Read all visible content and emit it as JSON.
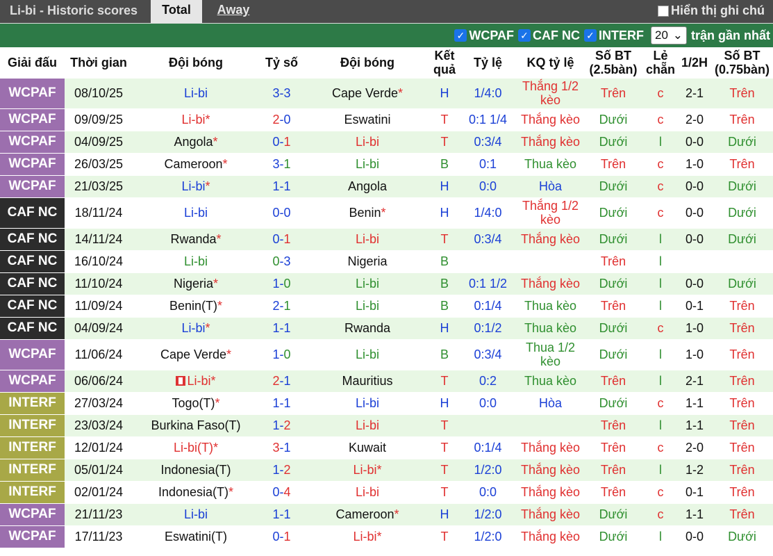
{
  "header": {
    "title": "Li-bi - Historic scores",
    "tabs": [
      "Total",
      "Away"
    ],
    "home_toggle_label": "Hiển thị ghi chú"
  },
  "filters": {
    "items": [
      "WCPAF",
      "CAF NC",
      "INTERF"
    ],
    "count_value": "20",
    "recent_label": "trận gần nhất"
  },
  "columns": [
    "Giải đấu",
    "Thời gian",
    "Đội bóng",
    "Tỷ số",
    "Đội bóng",
    "Kết quả",
    "Tỷ lệ",
    "KQ tỷ lệ",
    "Số BT (2.5bàn)",
    "Lẻ chẵn",
    "1/2H",
    "Số BT (0.75bàn)"
  ],
  "colors": {
    "WCPAF": "#9c6fae",
    "CAF NC": "#2c2c2c",
    "INTERF": "#a8a847",
    "win_text": "#e03030",
    "draw_text": "#1a3fd6",
    "loss_text": "#2f8f2f"
  },
  "rows": [
    {
      "league": "WCPAF",
      "date": "08/10/25",
      "home": "Li-bi",
      "home_star": false,
      "score_h": "3",
      "score_a": "3",
      "away": "Cape Verde",
      "away_star": true,
      "result": "H",
      "odds": "1/4:0",
      "odds_result": "Thắng 1/2 kèo",
      "ou": "Trên",
      "oe": "c",
      "half": "2-1",
      "ou2": "Trên"
    },
    {
      "league": "WCPAF",
      "date": "09/09/25",
      "home": "Li-bi",
      "home_star": true,
      "score_h": "2",
      "score_a": "0",
      "away": "Eswatini",
      "away_star": false,
      "result": "T",
      "odds": "0:1 1/4",
      "odds_result": "Thắng kèo",
      "ou": "Dưới",
      "oe": "c",
      "half": "2-0",
      "ou2": "Trên"
    },
    {
      "league": "WCPAF",
      "date": "04/09/25",
      "home": "Angola",
      "home_star": true,
      "score_h": "0",
      "score_a": "1",
      "away": "Li-bi",
      "away_star": false,
      "result": "T",
      "odds": "0:3/4",
      "odds_result": "Thắng kèo",
      "ou": "Dưới",
      "oe": "l",
      "half": "0-0",
      "ou2": "Dưới"
    },
    {
      "league": "WCPAF",
      "date": "26/03/25",
      "home": "Cameroon",
      "home_star": true,
      "score_h": "3",
      "score_a": "1",
      "away": "Li-bi",
      "away_star": false,
      "result": "B",
      "odds": "0:1",
      "odds_result": "Thua kèo",
      "ou": "Trên",
      "oe": "c",
      "half": "1-0",
      "ou2": "Trên"
    },
    {
      "league": "WCPAF",
      "date": "21/03/25",
      "home": "Li-bi",
      "home_star": true,
      "score_h": "1",
      "score_a": "1",
      "away": "Angola",
      "away_star": false,
      "result": "H",
      "odds": "0:0",
      "odds_result": "Hòa",
      "ou": "Dưới",
      "oe": "c",
      "half": "0-0",
      "ou2": "Dưới"
    },
    {
      "league": "CAF NC",
      "date": "18/11/24",
      "home": "Li-bi",
      "home_star": false,
      "score_h": "0",
      "score_a": "0",
      "away": "Benin",
      "away_star": true,
      "result": "H",
      "odds": "1/4:0",
      "odds_result": "Thắng 1/2 kèo",
      "ou": "Dưới",
      "oe": "c",
      "half": "0-0",
      "ou2": "Dưới"
    },
    {
      "league": "CAF NC",
      "date": "14/11/24",
      "home": "Rwanda",
      "home_star": true,
      "score_h": "0",
      "score_a": "1",
      "away": "Li-bi",
      "away_star": false,
      "result": "T",
      "odds": "0:3/4",
      "odds_result": "Thắng kèo",
      "ou": "Dưới",
      "oe": "l",
      "half": "0-0",
      "ou2": "Dưới"
    },
    {
      "league": "CAF NC",
      "date": "16/10/24",
      "home": "Li-bi",
      "home_star": false,
      "score_h": "0",
      "score_a": "3",
      "away": "Nigeria",
      "away_star": false,
      "result": "B",
      "odds": "",
      "odds_result": "",
      "ou": "Trên",
      "oe": "l",
      "half": "",
      "ou2": ""
    },
    {
      "league": "CAF NC",
      "date": "11/10/24",
      "home": "Nigeria",
      "home_star": true,
      "score_h": "1",
      "score_a": "0",
      "away": "Li-bi",
      "away_star": false,
      "result": "B",
      "odds": "0:1 1/2",
      "odds_result": "Thắng kèo",
      "ou": "Dưới",
      "oe": "l",
      "half": "0-0",
      "ou2": "Dưới"
    },
    {
      "league": "CAF NC",
      "date": "11/09/24",
      "home": "Benin(T)",
      "home_star": true,
      "score_h": "2",
      "score_a": "1",
      "away": "Li-bi",
      "away_star": false,
      "result": "B",
      "odds": "0:1/4",
      "odds_result": "Thua kèo",
      "ou": "Trên",
      "oe": "l",
      "half": "0-1",
      "ou2": "Trên"
    },
    {
      "league": "CAF NC",
      "date": "04/09/24",
      "home": "Li-bi",
      "home_star": true,
      "score_h": "1",
      "score_a": "1",
      "away": "Rwanda",
      "away_star": false,
      "result": "H",
      "odds": "0:1/2",
      "odds_result": "Thua kèo",
      "ou": "Dưới",
      "oe": "c",
      "half": "1-0",
      "ou2": "Trên"
    },
    {
      "league": "WCPAF",
      "date": "11/06/24",
      "home": "Cape Verde",
      "home_star": true,
      "score_h": "1",
      "score_a": "0",
      "away": "Li-bi",
      "away_star": false,
      "result": "B",
      "odds": "0:3/4",
      "odds_result": "Thua 1/2 kèo",
      "ou": "Dưới",
      "oe": "l",
      "half": "1-0",
      "ou2": "Trên"
    },
    {
      "league": "WCPAF",
      "date": "06/06/24",
      "home": "Li-bi",
      "home_star": true,
      "home_flag": true,
      "score_h": "2",
      "score_a": "1",
      "away": "Mauritius",
      "away_star": false,
      "result": "T",
      "odds": "0:2",
      "odds_result": "Thua kèo",
      "ou": "Trên",
      "oe": "l",
      "half": "2-1",
      "ou2": "Trên"
    },
    {
      "league": "INTERF",
      "date": "27/03/24",
      "home": "Togo(T)",
      "home_star": true,
      "score_h": "1",
      "score_a": "1",
      "away": "Li-bi",
      "away_star": false,
      "result": "H",
      "odds": "0:0",
      "odds_result": "Hòa",
      "ou": "Dưới",
      "oe": "c",
      "half": "1-1",
      "ou2": "Trên"
    },
    {
      "league": "INTERF",
      "date": "23/03/24",
      "home": "Burkina Faso(T)",
      "home_star": false,
      "score_h": "1",
      "score_a": "2",
      "away": "Li-bi",
      "away_star": false,
      "result": "T",
      "odds": "",
      "odds_result": "",
      "ou": "Trên",
      "oe": "l",
      "half": "1-1",
      "ou2": "Trên"
    },
    {
      "league": "INTERF",
      "date": "12/01/24",
      "home": "Li-bi(T)",
      "home_star": true,
      "score_h": "3",
      "score_a": "1",
      "away": "Kuwait",
      "away_star": false,
      "result": "T",
      "odds": "0:1/4",
      "odds_result": "Thắng kèo",
      "ou": "Trên",
      "oe": "c",
      "half": "2-0",
      "ou2": "Trên"
    },
    {
      "league": "INTERF",
      "date": "05/01/24",
      "home": "Indonesia(T)",
      "home_star": false,
      "score_h": "1",
      "score_a": "2",
      "away": "Li-bi",
      "away_star": true,
      "result": "T",
      "odds": "1/2:0",
      "odds_result": "Thắng kèo",
      "ou": "Trên",
      "oe": "l",
      "half": "1-2",
      "ou2": "Trên"
    },
    {
      "league": "INTERF",
      "date": "02/01/24",
      "home": "Indonesia(T)",
      "home_star": true,
      "score_h": "0",
      "score_a": "4",
      "away": "Li-bi",
      "away_star": false,
      "result": "T",
      "odds": "0:0",
      "odds_result": "Thắng kèo",
      "ou": "Trên",
      "oe": "c",
      "half": "0-1",
      "ou2": "Trên"
    },
    {
      "league": "WCPAF",
      "date": "21/11/23",
      "home": "Li-bi",
      "home_star": false,
      "score_h": "1",
      "score_a": "1",
      "away": "Cameroon",
      "away_star": true,
      "result": "H",
      "odds": "1/2:0",
      "odds_result": "Thắng kèo",
      "ou": "Dưới",
      "oe": "c",
      "half": "1-1",
      "ou2": "Trên"
    },
    {
      "league": "WCPAF",
      "date": "17/11/23",
      "home": "Eswatini(T)",
      "home_star": false,
      "score_h": "0",
      "score_a": "1",
      "away": "Li-bi",
      "away_star": true,
      "result": "T",
      "odds": "1/2:0",
      "odds_result": "Thắng kèo",
      "ou": "Dưới",
      "oe": "l",
      "half": "0-0",
      "ou2": "Dưới"
    }
  ]
}
